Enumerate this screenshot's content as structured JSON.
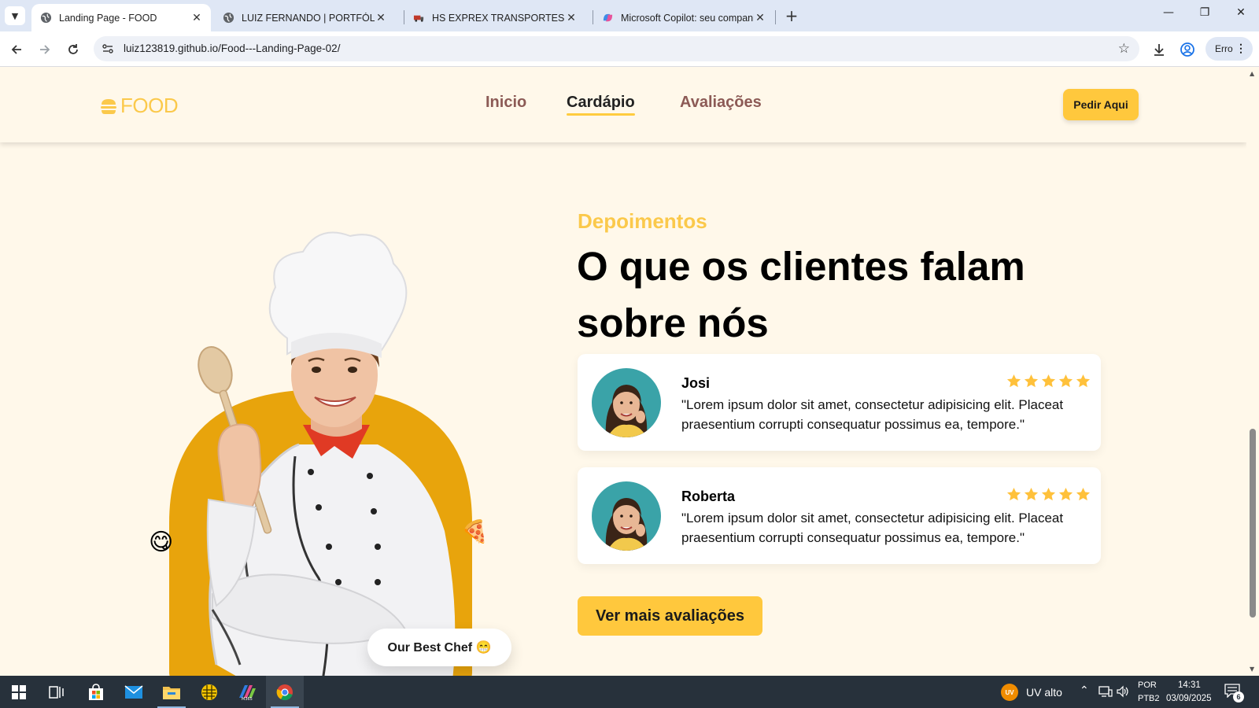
{
  "browser": {
    "tabs": [
      {
        "title": "Landing Page - FOOD",
        "active": true,
        "icon": "globe-icon"
      },
      {
        "title": "LUIZ FERNANDO | PORTFÓLIO",
        "active": false,
        "icon": "globe-icon"
      },
      {
        "title": "HS EXPREX TRANSPORTES",
        "active": false,
        "icon": "truck-favicon-icon"
      },
      {
        "title": "Microsoft Copilot: seu compani",
        "active": false,
        "icon": "copilot-icon"
      }
    ],
    "url": "luiz123819.github.io/Food---Landing-Page-02/",
    "profile_label": "Erro"
  },
  "site": {
    "logo_text": "FOOD",
    "nav": [
      {
        "label": "Inicio",
        "active": false
      },
      {
        "label": "Cardápio",
        "active": true
      },
      {
        "label": "Avaliações",
        "active": false
      }
    ],
    "cta_label": "Pedir Aqui",
    "chef_badge": "Our Best Chef 😁",
    "testimonials": {
      "eyebrow": "Depoimentos",
      "title": "O que os clientes falam sobre nós",
      "reviews": [
        {
          "name": "Josi",
          "rating": 5,
          "text": "\"Lorem ipsum dolor sit amet, consectetur adipisicing elit. Placeat praesentium corrupti consequatur possimus ea, tempore.\""
        },
        {
          "name": "Roberta",
          "rating": 5,
          "text": "\"Lorem ipsum dolor sit amet, consectetur adipisicing elit. Placeat praesentium corrupti consequatur possimus ea, tempore.\""
        }
      ],
      "more_label": "Ver mais avaliações"
    },
    "colors": {
      "accent": "#ffc83d",
      "eyebrow": "#fbc94b",
      "nav": "#8c5a55",
      "background": "#fff8ea",
      "chef_backdrop": "#e8a40c"
    }
  },
  "taskbar": {
    "uv_badge": "UV",
    "uv_label": "UV alto",
    "lang_top": "POR",
    "lang_bottom": "PTB2",
    "time": "14:31",
    "date": "03/09/2025",
    "notifications": "6",
    "apps": [
      "start-icon",
      "task-view-icon",
      "store-icon",
      "mail-icon",
      "file-explorer-icon",
      "game-icon",
      "m365-icon",
      "chrome-icon"
    ]
  }
}
